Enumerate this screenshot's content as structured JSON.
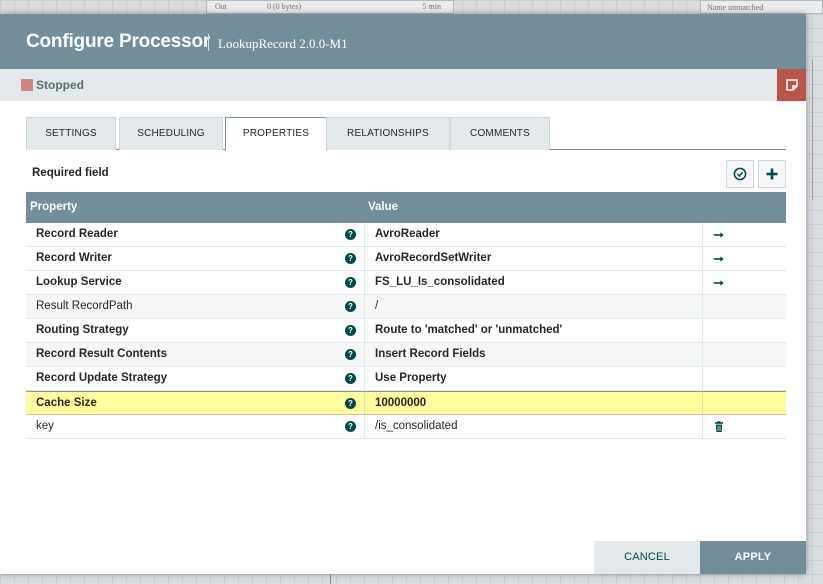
{
  "background": {
    "out_label": "Out",
    "out_bytes": "0 (0 bytes)",
    "out_time": "5 min",
    "relationship_name": "Name  unmatched"
  },
  "dialog": {
    "title": "Configure Processor",
    "subtitle": "LookupRecord 2.0.0-M1",
    "status": "Stopped",
    "status_color": "#d18686"
  },
  "tabs": [
    {
      "label": "SETTINGS"
    },
    {
      "label": "SCHEDULING"
    },
    {
      "label": "PROPERTIES"
    },
    {
      "label": "RELATIONSHIPS"
    },
    {
      "label": "COMMENTS"
    }
  ],
  "active_tab": "PROPERTIES",
  "required_field_label": "Required field",
  "table": {
    "col_property": "Property",
    "col_value": "Value",
    "rows": [
      {
        "name": "Record Reader",
        "value": "AvroReader",
        "required": true,
        "action": "goto-arrow-icon"
      },
      {
        "name": "Record Writer",
        "value": "AvroRecordSetWriter",
        "required": true,
        "action": "goto-arrow-icon"
      },
      {
        "name": "Lookup Service",
        "value": "FS_LU_Is_consolidated",
        "required": true,
        "action": "goto-arrow-icon"
      },
      {
        "name": "Result RecordPath",
        "value": "/",
        "required": false,
        "action": ""
      },
      {
        "name": "Routing Strategy",
        "value": "Route to 'matched' or 'unmatched'",
        "required": true,
        "action": ""
      },
      {
        "name": "Record Result Contents",
        "value": "Insert Record Fields",
        "required": true,
        "action": ""
      },
      {
        "name": "Record Update Strategy",
        "value": "Use Property",
        "required": true,
        "action": ""
      },
      {
        "name": "Cache Size",
        "value": "10000000",
        "required": true,
        "action": ""
      },
      {
        "name": "key",
        "value": "/is_consolidated",
        "required": false,
        "action": "trash-icon"
      }
    ]
  },
  "buttons": {
    "cancel": "CANCEL",
    "apply": "APPLY"
  },
  "colors": {
    "header": "#728e9b",
    "accent": "#004849",
    "highlight_row": "#fffc9c",
    "stop_button": "#ba554a"
  }
}
